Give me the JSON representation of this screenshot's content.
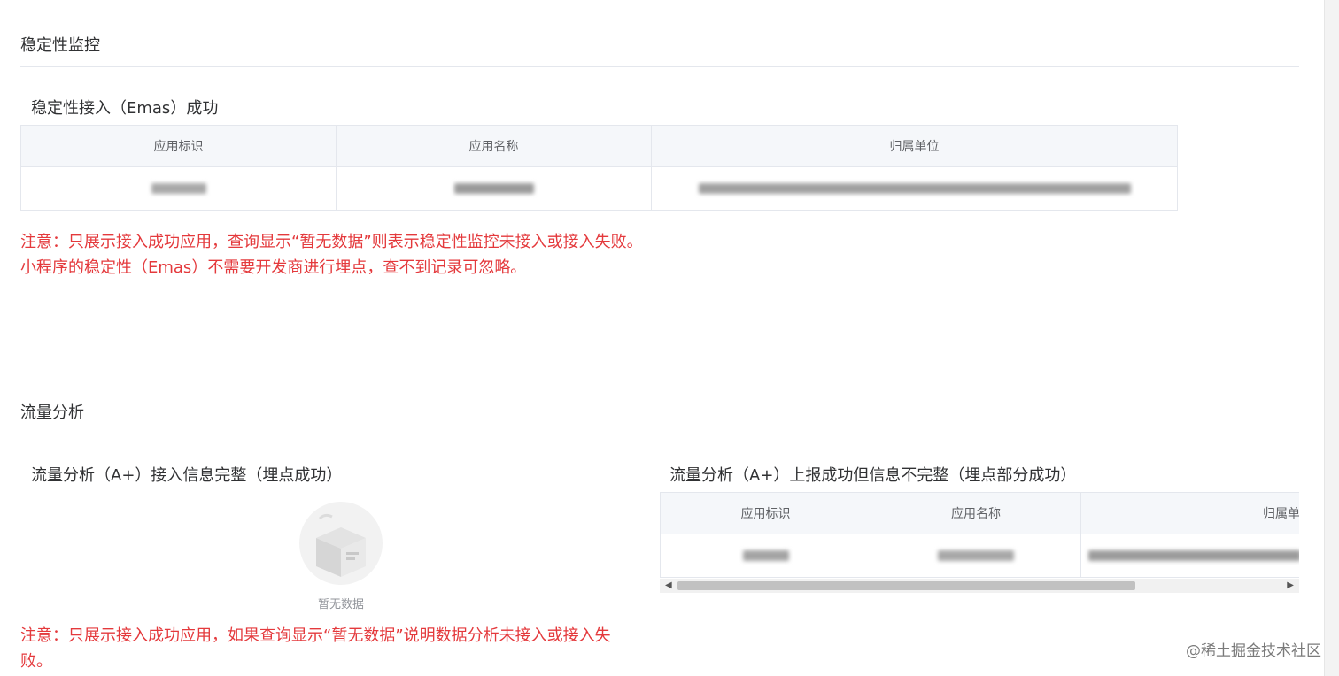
{
  "stability": {
    "section_title": "稳定性监控",
    "sub_title": "稳定性接入（Emas）成功",
    "columns": [
      "应用标识",
      "应用名称",
      "归属单位"
    ],
    "note_line1": "注意：只展示接入成功应用，查询显示“暂无数据”则表示稳定性监控未接入或接入失败。",
    "note_line2": "小程序的稳定性（Emas）不需要开发商进行埋点，查不到记录可忽略。"
  },
  "traffic": {
    "section_title": "流量分析",
    "complete_title": "流量分析（A+）接入信息完整（埋点成功）",
    "empty_text": "暂无数据",
    "incomplete_title": "流量分析（A+）上报成功但信息不完整（埋点部分成功）",
    "columns": [
      "应用标识",
      "应用名称",
      "归属单"
    ],
    "note": "注意：只展示接入成功应用，如果查询显示“暂无数据”说明数据分析未接入或接入失败。"
  },
  "footer": {
    "watermark": "@稀土掘金技术社区"
  },
  "colors": {
    "warning_red": "#e4393c",
    "header_bg": "#f5f7fa",
    "border": "#e4e7ed"
  }
}
